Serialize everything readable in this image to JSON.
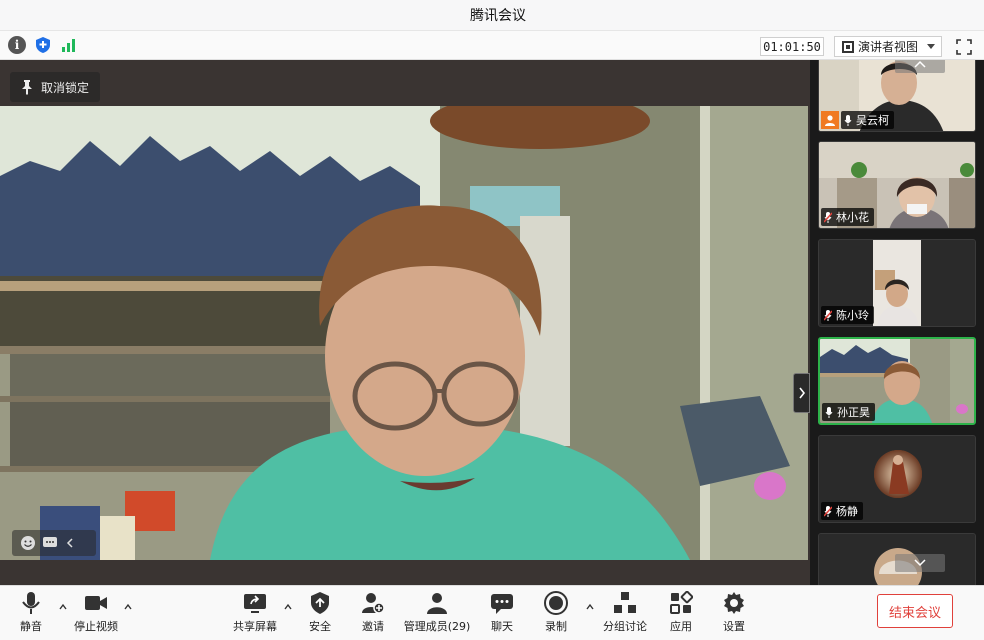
{
  "window": {
    "title": "腾讯会议"
  },
  "status_bar": {
    "timer": "01:01:50",
    "view_mode": "演讲者视图",
    "icons": [
      "info-icon",
      "shield-icon",
      "signal-icon",
      "fullscreen-icon"
    ],
    "signal_color": "#1fb85a"
  },
  "main_view": {
    "pin_label": "取消锁定"
  },
  "participants": [
    {
      "name": "吴云柯",
      "mic": "on",
      "role_badge": "host"
    },
    {
      "name": "林小花",
      "mic": "muted"
    },
    {
      "name": "陈小玲",
      "mic": "muted"
    },
    {
      "name": "孙正昊",
      "mic": "on",
      "active": true
    },
    {
      "name": "杨静",
      "mic": "muted"
    },
    {
      "name": "",
      "mic": "",
      "partial": true
    }
  ],
  "toolbar": {
    "mute_label": "静音",
    "video_label": "停止视频",
    "share_label": "共享屏幕",
    "security_label": "安全",
    "invite_label": "邀请",
    "members_label": "管理成员(29)",
    "chat_label": "聊天",
    "record_label": "录制",
    "breakout_label": "分组讨论",
    "apps_label": "应用",
    "settings_label": "设置",
    "end_label": "结束会议"
  },
  "colors": {
    "accent_red": "#e0413b",
    "active_border": "#2db34a",
    "host_badge": "#f07a22"
  }
}
